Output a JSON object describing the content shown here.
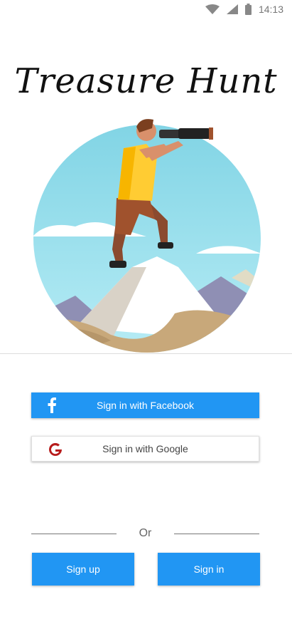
{
  "status_bar": {
    "time": "14:13",
    "icons": [
      "wifi-icon",
      "cell-signal-icon",
      "battery-icon"
    ]
  },
  "app": {
    "title": "Treasure Hunt",
    "hero_image": "explorer-with-telescope-illustration"
  },
  "auth": {
    "facebook_label": "Sign in with Facebook",
    "google_label": "Sign in with Google",
    "or_label": "Or",
    "signup_label": "Sign up",
    "signin_label": "Sign in"
  },
  "colors": {
    "primary": "#2196f3",
    "google_red": "#b71c1c"
  }
}
